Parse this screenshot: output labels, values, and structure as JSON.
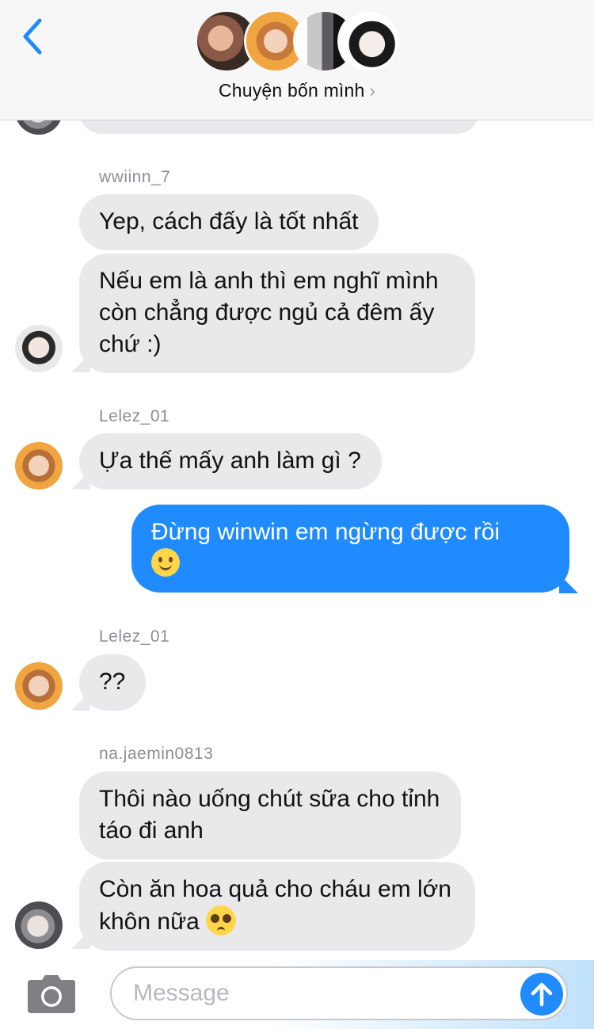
{
  "header": {
    "group_name": "Chuyện bốn mình",
    "group_chevron": "›"
  },
  "messages": [
    {
      "sender": "wwiinn_7",
      "text": "Yep, cách đấy là tốt nhất"
    },
    {
      "text": "Nếu em là anh thì em nghĩ mình còn chẳng được ngủ cả đêm ấy chứ :)"
    },
    {
      "sender": "Lelez_01",
      "text": "Ựa thế mấy anh làm gì ?"
    },
    {
      "text": "Đừng winwin em ngừng được rồi",
      "emoji": "slightly-smiling-face"
    },
    {
      "sender": "Lelez_01",
      "text": "??"
    },
    {
      "sender": "na.jaemin0813",
      "text": "Thôi nào uống chút sữa cho tỉnh táo đi anh"
    },
    {
      "text": "Còn ăn hoa quả cho cháu em lớn khôn nữa",
      "emoji": "pleading-face"
    }
  ],
  "input": {
    "placeholder": "Message",
    "value": ""
  },
  "colors": {
    "outgoing_bubble": "#1f8bff",
    "incoming_bubble": "#e9e9eb",
    "back_accent": "#1f8bff"
  },
  "icons": {
    "back": "chevron-left-icon",
    "camera": "camera-icon",
    "send": "arrow-up-icon"
  }
}
